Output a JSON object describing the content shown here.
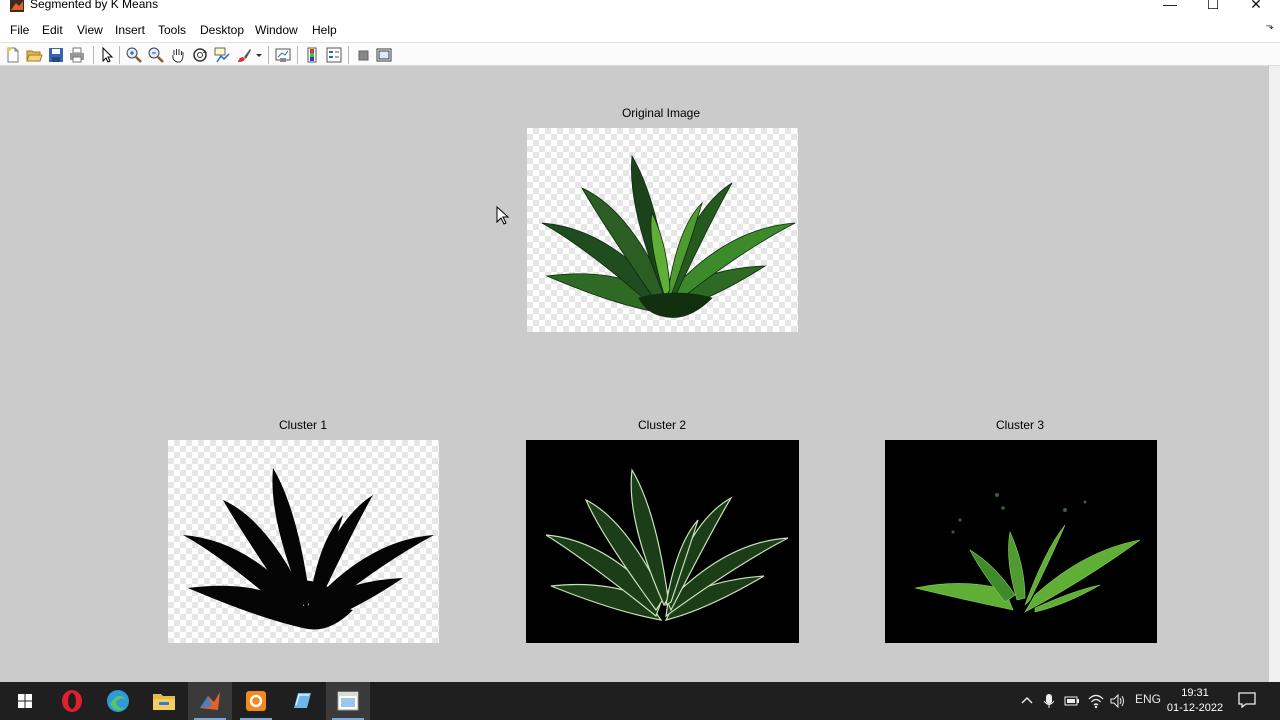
{
  "window": {
    "title": "Segmented by K Means",
    "controls": {
      "minimize": "—",
      "maximize": "☐",
      "close": "✕"
    }
  },
  "menu": [
    "File",
    "Edit",
    "View",
    "Insert",
    "Tools",
    "Desktop",
    "Window",
    "Help"
  ],
  "toolbar": {
    "icons": [
      "new-figure-icon",
      "open-file-icon",
      "save-icon",
      "print-icon",
      "edit-plot-icon",
      "zoom-in-icon",
      "zoom-out-icon",
      "pan-icon",
      "rotate-3d-icon",
      "data-cursor-icon",
      "brush-icon",
      "link-plot-icon",
      "colorbar-icon",
      "legend-icon",
      "hide-plot-tools-icon",
      "show-plot-tools-icon"
    ]
  },
  "figure": {
    "original": {
      "title": "Original Image"
    },
    "cluster1": {
      "title": "Cluster 1"
    },
    "cluster2": {
      "title": "Cluster 2"
    },
    "cluster3": {
      "title": "Cluster 3"
    }
  },
  "taskbar": {
    "apps": [
      "start-icon",
      "opera-icon",
      "edge-icon",
      "file-explorer-icon",
      "matlab-icon",
      "presentation-icon",
      "notepad-icon",
      "figure-window-icon"
    ],
    "language": "ENG",
    "time": "19:31",
    "date": "01-12-2022"
  },
  "colors": {
    "figure_bg": "#cbcbcb",
    "plant_dark": "#1f4d1f",
    "plant_light": "#5fae35",
    "taskbar": "#1f1f1f"
  }
}
